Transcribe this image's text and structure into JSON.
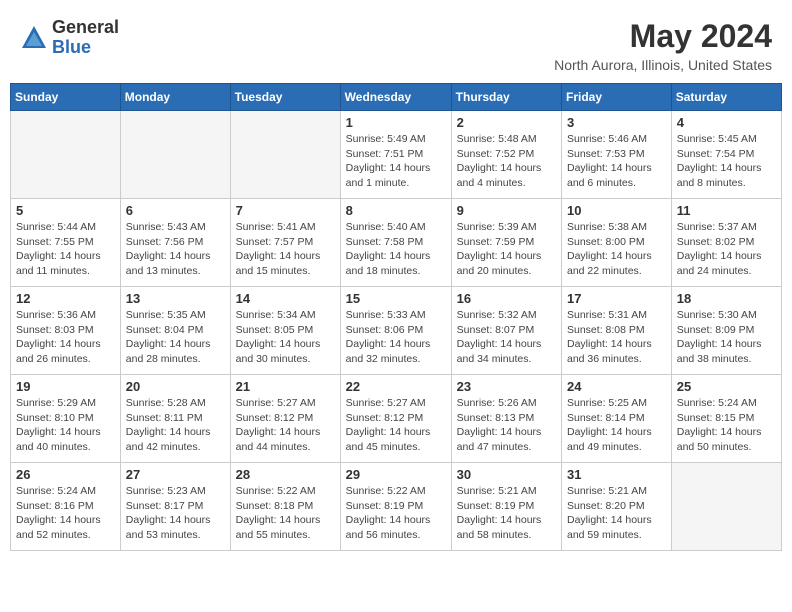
{
  "header": {
    "logo_line1": "General",
    "logo_line2": "Blue",
    "month": "May 2024",
    "location": "North Aurora, Illinois, United States"
  },
  "days_of_week": [
    "Sunday",
    "Monday",
    "Tuesday",
    "Wednesday",
    "Thursday",
    "Friday",
    "Saturday"
  ],
  "weeks": [
    [
      {
        "day": "",
        "info": ""
      },
      {
        "day": "",
        "info": ""
      },
      {
        "day": "",
        "info": ""
      },
      {
        "day": "1",
        "info": "Sunrise: 5:49 AM\nSunset: 7:51 PM\nDaylight: 14 hours\nand 1 minute."
      },
      {
        "day": "2",
        "info": "Sunrise: 5:48 AM\nSunset: 7:52 PM\nDaylight: 14 hours\nand 4 minutes."
      },
      {
        "day": "3",
        "info": "Sunrise: 5:46 AM\nSunset: 7:53 PM\nDaylight: 14 hours\nand 6 minutes."
      },
      {
        "day": "4",
        "info": "Sunrise: 5:45 AM\nSunset: 7:54 PM\nDaylight: 14 hours\nand 8 minutes."
      }
    ],
    [
      {
        "day": "5",
        "info": "Sunrise: 5:44 AM\nSunset: 7:55 PM\nDaylight: 14 hours\nand 11 minutes."
      },
      {
        "day": "6",
        "info": "Sunrise: 5:43 AM\nSunset: 7:56 PM\nDaylight: 14 hours\nand 13 minutes."
      },
      {
        "day": "7",
        "info": "Sunrise: 5:41 AM\nSunset: 7:57 PM\nDaylight: 14 hours\nand 15 minutes."
      },
      {
        "day": "8",
        "info": "Sunrise: 5:40 AM\nSunset: 7:58 PM\nDaylight: 14 hours\nand 18 minutes."
      },
      {
        "day": "9",
        "info": "Sunrise: 5:39 AM\nSunset: 7:59 PM\nDaylight: 14 hours\nand 20 minutes."
      },
      {
        "day": "10",
        "info": "Sunrise: 5:38 AM\nSunset: 8:00 PM\nDaylight: 14 hours\nand 22 minutes."
      },
      {
        "day": "11",
        "info": "Sunrise: 5:37 AM\nSunset: 8:02 PM\nDaylight: 14 hours\nand 24 minutes."
      }
    ],
    [
      {
        "day": "12",
        "info": "Sunrise: 5:36 AM\nSunset: 8:03 PM\nDaylight: 14 hours\nand 26 minutes."
      },
      {
        "day": "13",
        "info": "Sunrise: 5:35 AM\nSunset: 8:04 PM\nDaylight: 14 hours\nand 28 minutes."
      },
      {
        "day": "14",
        "info": "Sunrise: 5:34 AM\nSunset: 8:05 PM\nDaylight: 14 hours\nand 30 minutes."
      },
      {
        "day": "15",
        "info": "Sunrise: 5:33 AM\nSunset: 8:06 PM\nDaylight: 14 hours\nand 32 minutes."
      },
      {
        "day": "16",
        "info": "Sunrise: 5:32 AM\nSunset: 8:07 PM\nDaylight: 14 hours\nand 34 minutes."
      },
      {
        "day": "17",
        "info": "Sunrise: 5:31 AM\nSunset: 8:08 PM\nDaylight: 14 hours\nand 36 minutes."
      },
      {
        "day": "18",
        "info": "Sunrise: 5:30 AM\nSunset: 8:09 PM\nDaylight: 14 hours\nand 38 minutes."
      }
    ],
    [
      {
        "day": "19",
        "info": "Sunrise: 5:29 AM\nSunset: 8:10 PM\nDaylight: 14 hours\nand 40 minutes."
      },
      {
        "day": "20",
        "info": "Sunrise: 5:28 AM\nSunset: 8:11 PM\nDaylight: 14 hours\nand 42 minutes."
      },
      {
        "day": "21",
        "info": "Sunrise: 5:27 AM\nSunset: 8:12 PM\nDaylight: 14 hours\nand 44 minutes."
      },
      {
        "day": "22",
        "info": "Sunrise: 5:27 AM\nSunset: 8:12 PM\nDaylight: 14 hours\nand 45 minutes."
      },
      {
        "day": "23",
        "info": "Sunrise: 5:26 AM\nSunset: 8:13 PM\nDaylight: 14 hours\nand 47 minutes."
      },
      {
        "day": "24",
        "info": "Sunrise: 5:25 AM\nSunset: 8:14 PM\nDaylight: 14 hours\nand 49 minutes."
      },
      {
        "day": "25",
        "info": "Sunrise: 5:24 AM\nSunset: 8:15 PM\nDaylight: 14 hours\nand 50 minutes."
      }
    ],
    [
      {
        "day": "26",
        "info": "Sunrise: 5:24 AM\nSunset: 8:16 PM\nDaylight: 14 hours\nand 52 minutes."
      },
      {
        "day": "27",
        "info": "Sunrise: 5:23 AM\nSunset: 8:17 PM\nDaylight: 14 hours\nand 53 minutes."
      },
      {
        "day": "28",
        "info": "Sunrise: 5:22 AM\nSunset: 8:18 PM\nDaylight: 14 hours\nand 55 minutes."
      },
      {
        "day": "29",
        "info": "Sunrise: 5:22 AM\nSunset: 8:19 PM\nDaylight: 14 hours\nand 56 minutes."
      },
      {
        "day": "30",
        "info": "Sunrise: 5:21 AM\nSunset: 8:19 PM\nDaylight: 14 hours\nand 58 minutes."
      },
      {
        "day": "31",
        "info": "Sunrise: 5:21 AM\nSunset: 8:20 PM\nDaylight: 14 hours\nand 59 minutes."
      },
      {
        "day": "",
        "info": ""
      }
    ]
  ]
}
